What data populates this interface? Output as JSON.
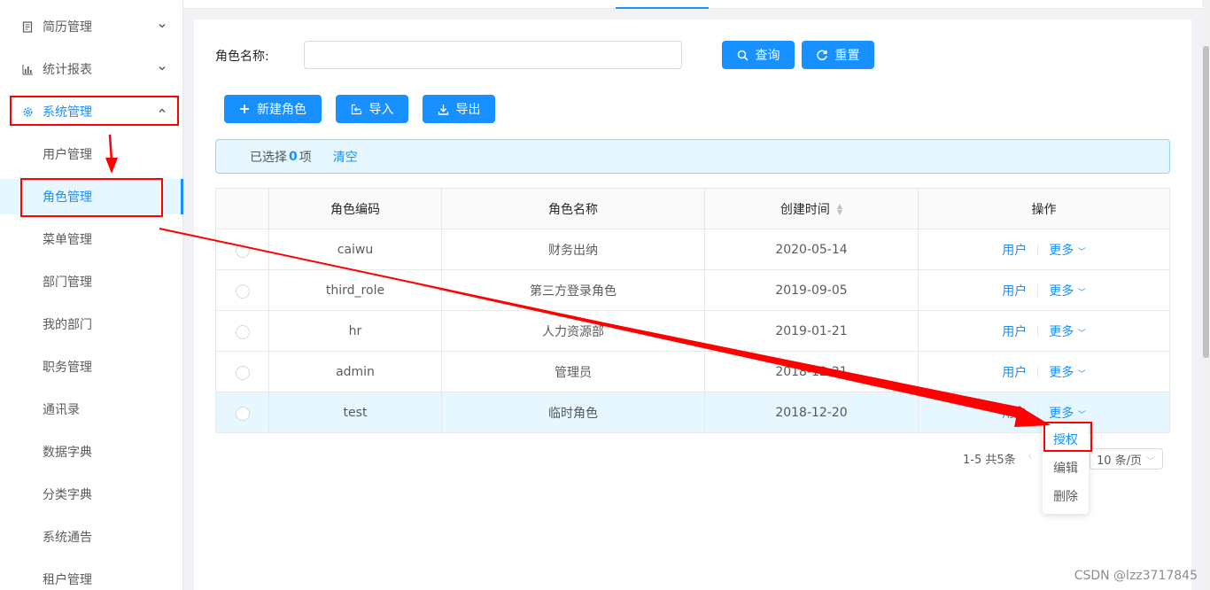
{
  "sidebar": {
    "groups": [
      {
        "label": "简历管理",
        "icon": "resume-icon"
      },
      {
        "label": "统计报表",
        "icon": "bar-chart-icon"
      },
      {
        "label": "系统管理",
        "icon": "gear-icon"
      }
    ],
    "items": [
      {
        "label": "用户管理"
      },
      {
        "label": "角色管理"
      },
      {
        "label": "菜单管理"
      },
      {
        "label": "部门管理"
      },
      {
        "label": "我的部门"
      },
      {
        "label": "职务管理"
      },
      {
        "label": "通讯录"
      },
      {
        "label": "数据字典"
      },
      {
        "label": "分类字典"
      },
      {
        "label": "系统通告"
      },
      {
        "label": "租户管理"
      }
    ]
  },
  "search": {
    "label": "角色名称:",
    "value": "",
    "placeholder": "",
    "query_label": "查询",
    "reset_label": "重置"
  },
  "toolbar": {
    "new_label": "新建角色",
    "import_label": "导入",
    "export_label": "导出"
  },
  "selection": {
    "prefix": "已选择",
    "count": "0",
    "suffix": "项",
    "clear_label": "清空"
  },
  "table": {
    "columns": [
      "角色编码",
      "角色名称",
      "创建时间",
      "操作"
    ],
    "rows": [
      {
        "code": "caiwu",
        "name": "财务出纳",
        "created": "2020-05-14"
      },
      {
        "code": "third_role",
        "name": "第三方登录角色",
        "created": "2019-09-05"
      },
      {
        "code": "hr",
        "name": "人力资源部",
        "created": "2019-01-21"
      },
      {
        "code": "admin",
        "name": "管理员",
        "created": "2018-12-21"
      },
      {
        "code": "test",
        "name": "临时角色",
        "created": "2018-12-20"
      }
    ],
    "action_user": "用户",
    "action_more": "更多"
  },
  "pagination": {
    "summary": "1-5 共5条",
    "page_size": "10 条/页"
  },
  "dropdown": {
    "items": [
      "授权",
      "编辑",
      "删除"
    ]
  },
  "watermark": "CSDN @lzz3717845",
  "colors": {
    "primary": "#1890ff",
    "annotation": "#ff0000"
  }
}
